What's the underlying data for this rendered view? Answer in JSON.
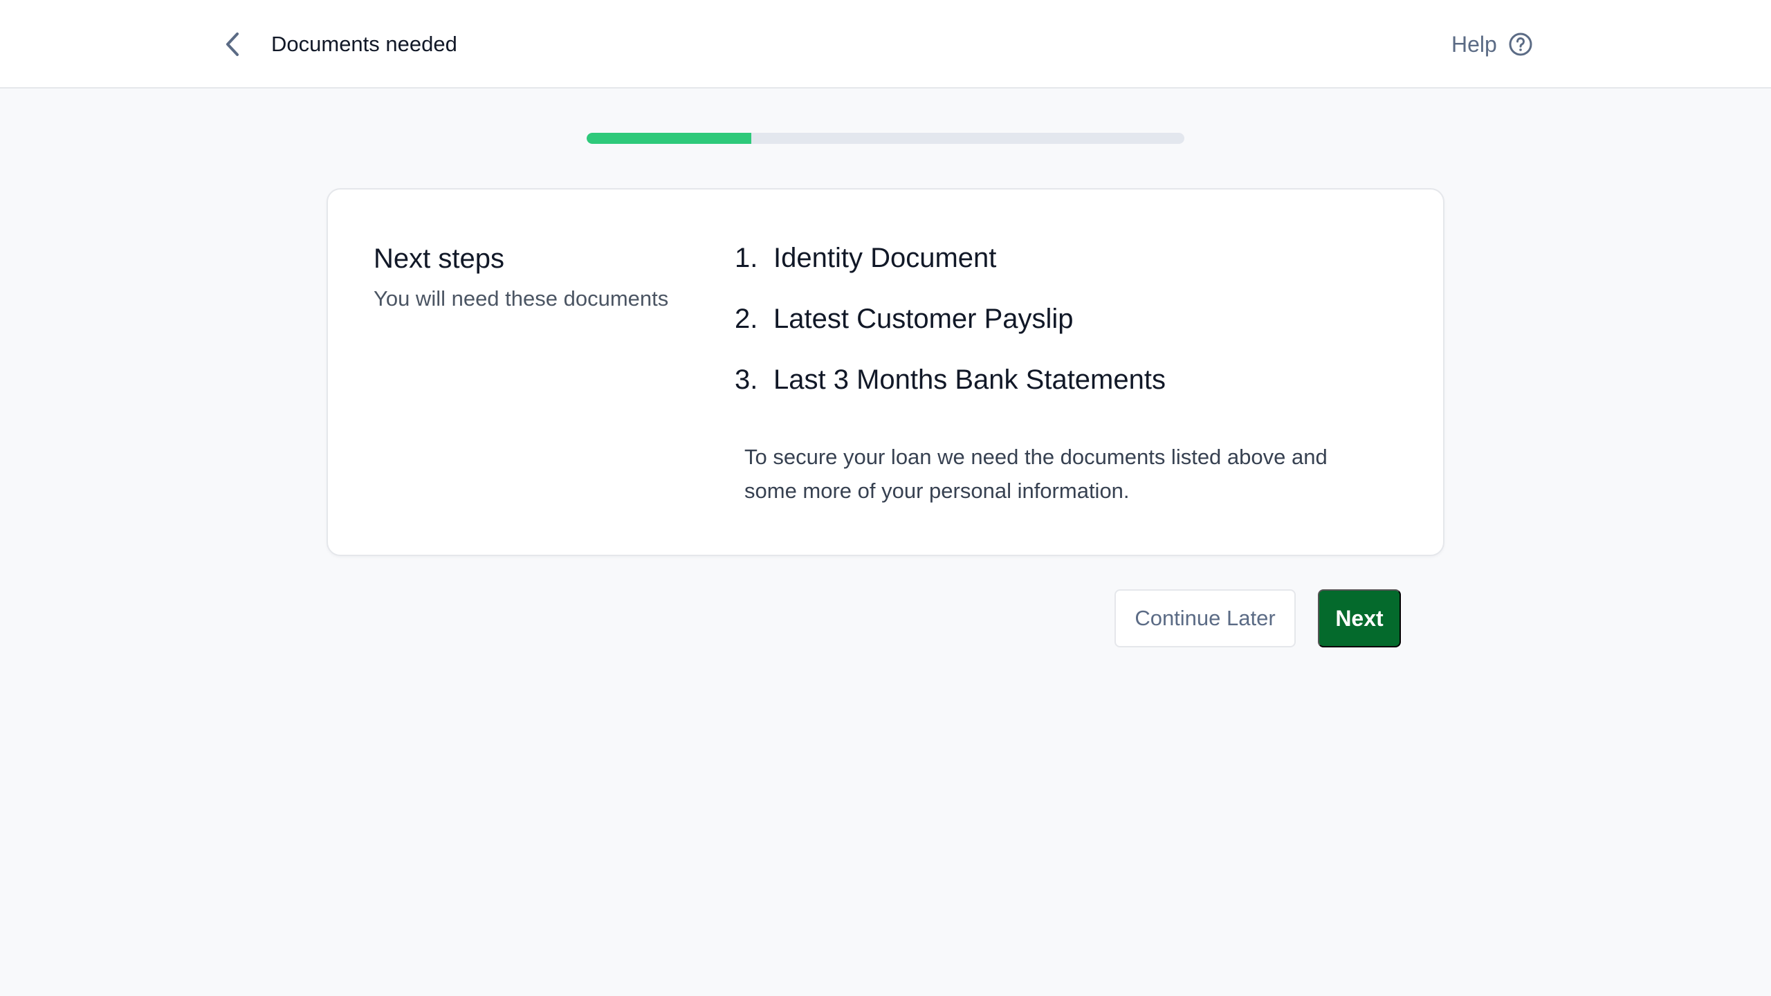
{
  "header": {
    "back_icon": "chevron-left-icon",
    "title": "Documents needed",
    "help_label": "Help",
    "help_icon": "question-circle-icon"
  },
  "progress": {
    "fraction": 0.275,
    "fill_color": "#2ec97a",
    "track_color": "#e3e7ee"
  },
  "card": {
    "heading": "Next steps",
    "subheading": "You will need these documents",
    "documents": [
      {
        "number": "1.",
        "label": "Identity Document"
      },
      {
        "number": "2.",
        "label": "Latest Customer Payslip"
      },
      {
        "number": "3.",
        "label": "Last 3 Months Bank Statements"
      }
    ],
    "note": "To secure your loan we need the documents listed above and some more of your personal information."
  },
  "actions": {
    "continue_later_label": "Continue Later",
    "next_label": "Next",
    "primary_color": "#046a2c"
  }
}
